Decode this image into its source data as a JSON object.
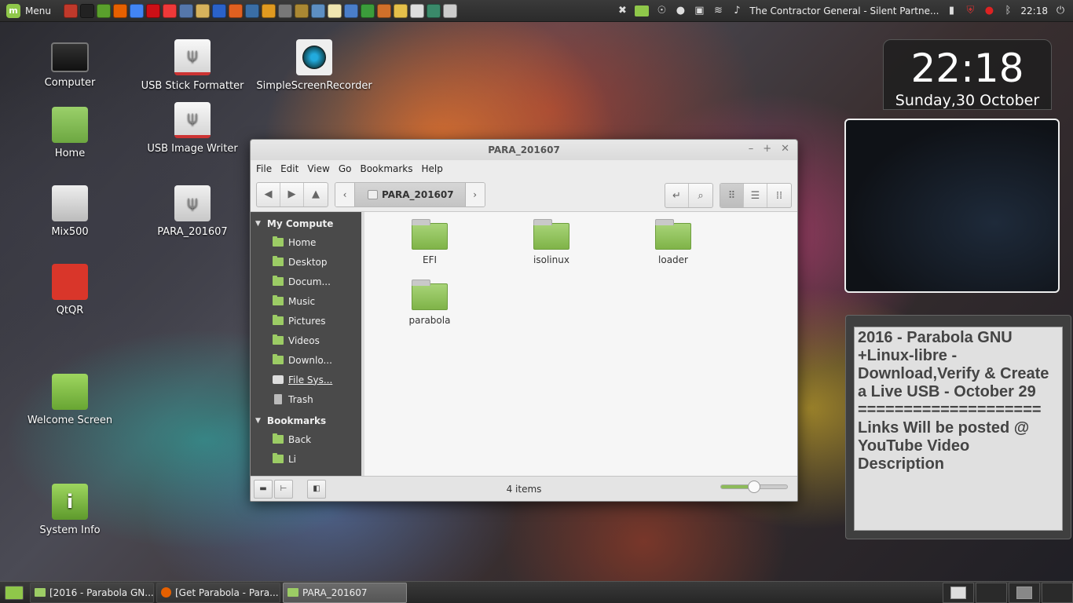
{
  "top_panel": {
    "menu_label": "Menu",
    "launchers": [
      {
        "icon": "brick-icon",
        "color": "#c0392b"
      },
      {
        "icon": "terminal-icon",
        "color": "#222222"
      },
      {
        "icon": "software-manager-icon",
        "color": "#5aa02c"
      },
      {
        "icon": "firefox-icon",
        "color": "#e66000"
      },
      {
        "icon": "chrome-icon",
        "color": "#4285f4"
      },
      {
        "icon": "opera-icon",
        "color": "#cc0f16"
      },
      {
        "icon": "vivaldi-icon",
        "color": "#ef3939"
      },
      {
        "icon": "app-icon",
        "color": "#5577aa"
      },
      {
        "icon": "mail-icon",
        "color": "#d6b25c"
      },
      {
        "icon": "browser-icon",
        "color": "#2a62c9"
      },
      {
        "icon": "media-icon",
        "color": "#e06020"
      },
      {
        "icon": "network-icon",
        "color": "#3a6ea5"
      },
      {
        "icon": "app-icon",
        "color": "#e09a20"
      },
      {
        "icon": "app-icon",
        "color": "#777777"
      },
      {
        "icon": "monitor-icon",
        "color": "#aa8833"
      },
      {
        "icon": "image-icon",
        "color": "#5d8fc2"
      },
      {
        "icon": "text-editor-icon",
        "color": "#f0e6b0"
      },
      {
        "icon": "document-icon",
        "color": "#4a7ec9"
      },
      {
        "icon": "spreadsheet-icon",
        "color": "#3b9d3b"
      },
      {
        "icon": "presentation-icon",
        "color": "#d0702a"
      },
      {
        "icon": "puzzle-icon",
        "color": "#e5c04a"
      },
      {
        "icon": "disc-icon",
        "color": "#dddddd"
      },
      {
        "icon": "target-icon",
        "color": "#3a8a6a"
      },
      {
        "icon": "camera-icon",
        "color": "#cccccc"
      }
    ],
    "now_playing": "The Contractor General - Silent Partne...",
    "clock": "22:18"
  },
  "desktop_icons": [
    {
      "label": "Computer",
      "icon": "computer-icon"
    },
    {
      "label": "Home",
      "icon": "home-folder-icon"
    },
    {
      "label": "Mix500",
      "icon": "hard-drive-icon"
    },
    {
      "label": "QtQR",
      "icon": "qr-code-icon"
    },
    {
      "label": "Welcome Screen",
      "icon": "mint-logo-icon"
    },
    {
      "label": "System Info",
      "icon": "info-icon"
    },
    {
      "label": "USB Stick Formatter",
      "icon": "usb-formatter-icon"
    },
    {
      "label": "USB Image Writer",
      "icon": "usb-writer-icon"
    },
    {
      "label": "PARA_201607",
      "icon": "usb-drive-icon"
    },
    {
      "label": "SimpleScreenRecorder",
      "icon": "screen-recorder-icon"
    }
  ],
  "file_manager": {
    "title": "PARA_201607",
    "menu": [
      "File",
      "Edit",
      "View",
      "Go",
      "Bookmarks",
      "Help"
    ],
    "breadcrumb": "PARA_201607",
    "sidebar": {
      "sections": [
        {
          "header": "My Compute",
          "items": [
            {
              "label": "Home",
              "icon": "home-folder-icon"
            },
            {
              "label": "Desktop",
              "icon": "desktop-folder-icon"
            },
            {
              "label": "Docum...",
              "icon": "documents-folder-icon"
            },
            {
              "label": "Music",
              "icon": "music-folder-icon"
            },
            {
              "label": "Pictures",
              "icon": "pictures-folder-icon"
            },
            {
              "label": "Videos",
              "icon": "videos-folder-icon"
            },
            {
              "label": "Downlo...",
              "icon": "downloads-folder-icon"
            },
            {
              "label": "File Sys...",
              "icon": "filesystem-icon"
            },
            {
              "label": "Trash",
              "icon": "trash-icon"
            }
          ]
        },
        {
          "header": "Bookmarks",
          "items": [
            {
              "label": "Back",
              "icon": "folder-icon"
            },
            {
              "label": "Li",
              "icon": "folder-icon"
            }
          ]
        }
      ]
    },
    "files": [
      "EFI",
      "isolinux",
      "loader",
      "parabola"
    ],
    "status": "4 items",
    "zoom_level": 0.5
  },
  "clock_widget": {
    "time": "22:18",
    "date": "Sunday,30 October"
  },
  "notes_widget": {
    "text": "2016 - Parabola GNU +Linux-libre - Download,Verify & Create a Live USB - October 29\n====================\nLinks Will be posted @ YouTube Video Description"
  },
  "taskbar": {
    "tasks": [
      {
        "label": "[2016 - Parabola GN...",
        "icon": "folder-icon",
        "active": false
      },
      {
        "label": "[Get Parabola - Para...",
        "icon": "firefox-icon",
        "active": false
      },
      {
        "label": "PARA_201607",
        "icon": "folder-icon",
        "active": true
      }
    ]
  },
  "colors": {
    "accent_green": "#8fc74a",
    "sidebar_bg": "#4a4a4a",
    "folder_green": "#9ccc65"
  }
}
